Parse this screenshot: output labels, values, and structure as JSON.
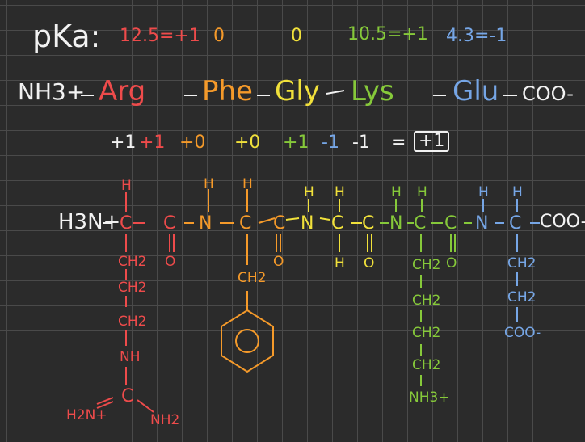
{
  "pka": {
    "label": "pKa:",
    "arg": "12.5=+1",
    "phe": "0",
    "gly": "0",
    "lys": "10.5=+1",
    "glu": "4.3=-1"
  },
  "peptide": {
    "n_term": "NH3+",
    "residues": [
      "Arg",
      "Phe",
      "Gly",
      "Lys",
      "Glu"
    ],
    "c_term": "COO-"
  },
  "charges": {
    "terms": [
      "+1",
      "+1",
      "+0",
      "+0",
      "+1",
      "-1",
      "-1"
    ],
    "equals": "=",
    "total": "+1"
  },
  "structure": {
    "n_term": "H3N+",
    "c_term": "COO-",
    "arg_side": [
      "CH2",
      "CH2",
      "CH2",
      "NH",
      "C",
      "H2N+",
      "NH2"
    ],
    "phe_side": [
      "CH2"
    ],
    "gly_side": [
      "H"
    ],
    "lys_side": [
      "CH2",
      "CH2",
      "CH2",
      "CH2",
      "NH3+"
    ],
    "glu_side": [
      "CH2",
      "CH2",
      "COO-"
    ],
    "h_label": "H",
    "n_label": "N",
    "c_label": "C",
    "o_label": "O"
  },
  "colors": {
    "background": "#2b2b2b",
    "arg": "#ee4b4b",
    "phe": "#f59a2a",
    "gly": "#f1e13b",
    "lys": "#86c93a",
    "glu": "#76a6e6",
    "ink": "#f2f2f2"
  }
}
